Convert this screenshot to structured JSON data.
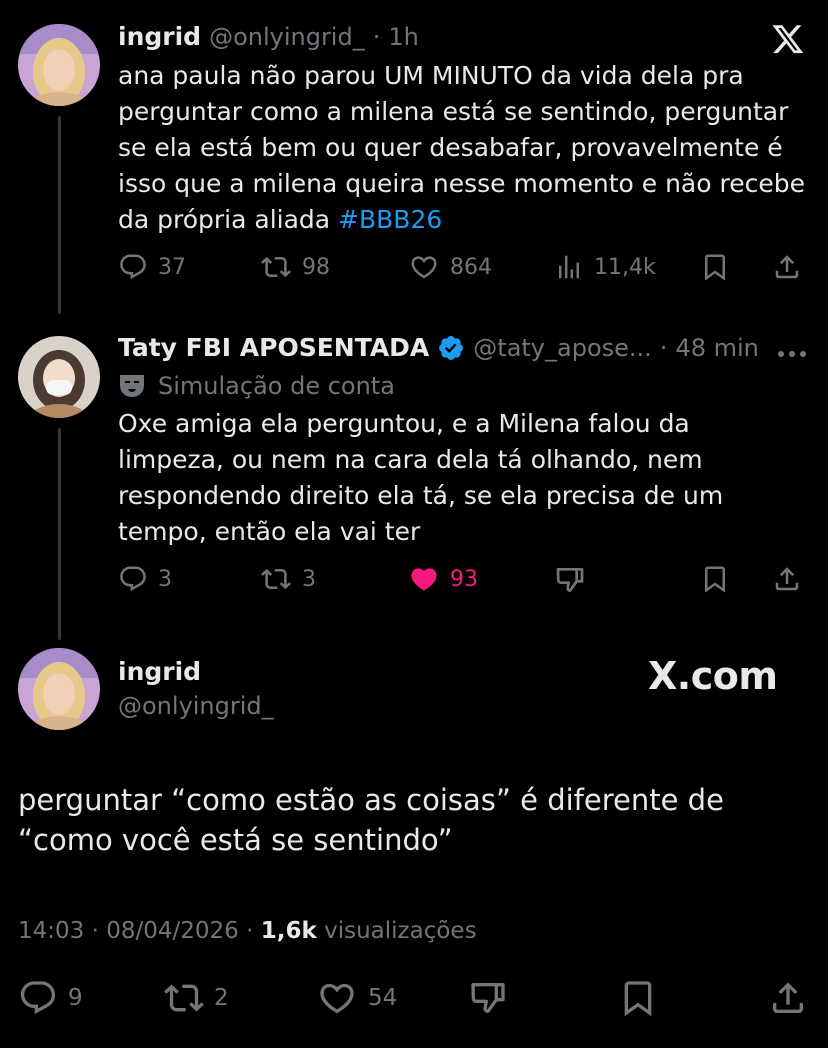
{
  "colors": {
    "background": "#000000",
    "text": "#e7e9ea",
    "muted": "#71767b",
    "link": "#1d9bf0",
    "like": "#f91880",
    "verified": "#1d9bf0"
  },
  "tweet1": {
    "name": "ingrid",
    "handle": "@onlyingrid_",
    "sep": "·",
    "time": "1h",
    "text_before": "ana paula não parou UM MINUTO da vida dela pra perguntar como a milena está se sentindo, perguntar se ela está bem ou quer desabafar, provavelmente é isso que a milena queira nesse momento e não recebe da própria aliada ",
    "hashtag": "#BBB26",
    "actions": {
      "replies": "37",
      "retweets": "98",
      "likes": "864",
      "views": "11,4k"
    },
    "icons": [
      "x-logo-icon",
      "reply-icon",
      "retweet-icon",
      "like-icon",
      "views-icon",
      "bookmark-icon",
      "share-icon"
    ]
  },
  "tweet2": {
    "name": "Taty FBI APOSENTADA",
    "handle": "@taty_apose...",
    "sep": "·",
    "time": "48 min",
    "label": "Simulação de conta",
    "text": "Oxe amiga ela perguntou, e a Milena falou da limpeza, ou nem na cara dela tá olhando, nem respondendo direito ela tá, se ela precisa de um tempo, então ela vai ter",
    "actions": {
      "replies": "3",
      "retweets": "3",
      "likes": "93"
    },
    "icons": [
      "verified-badge-icon",
      "more-icon",
      "parody-mask-icon",
      "reply-icon",
      "retweet-icon",
      "like-filled-icon",
      "dislike-icon",
      "bookmark-icon",
      "share-icon"
    ]
  },
  "main": {
    "name": "ingrid",
    "handle": "@onlyingrid_",
    "watermark": "X.com",
    "text": "perguntar “como estão as coisas” é diferente de “como você está se sentindo”",
    "time": "14:03",
    "sep1": "·",
    "date": "08/04/2026",
    "sep2": "·",
    "views_count": "1,6k",
    "views_label": "visualizações",
    "actions": {
      "replies": "9",
      "retweets": "2",
      "likes": "54"
    },
    "icons": [
      "reply-icon",
      "retweet-icon",
      "like-icon",
      "dislike-icon",
      "bookmark-icon",
      "share-icon"
    ]
  }
}
